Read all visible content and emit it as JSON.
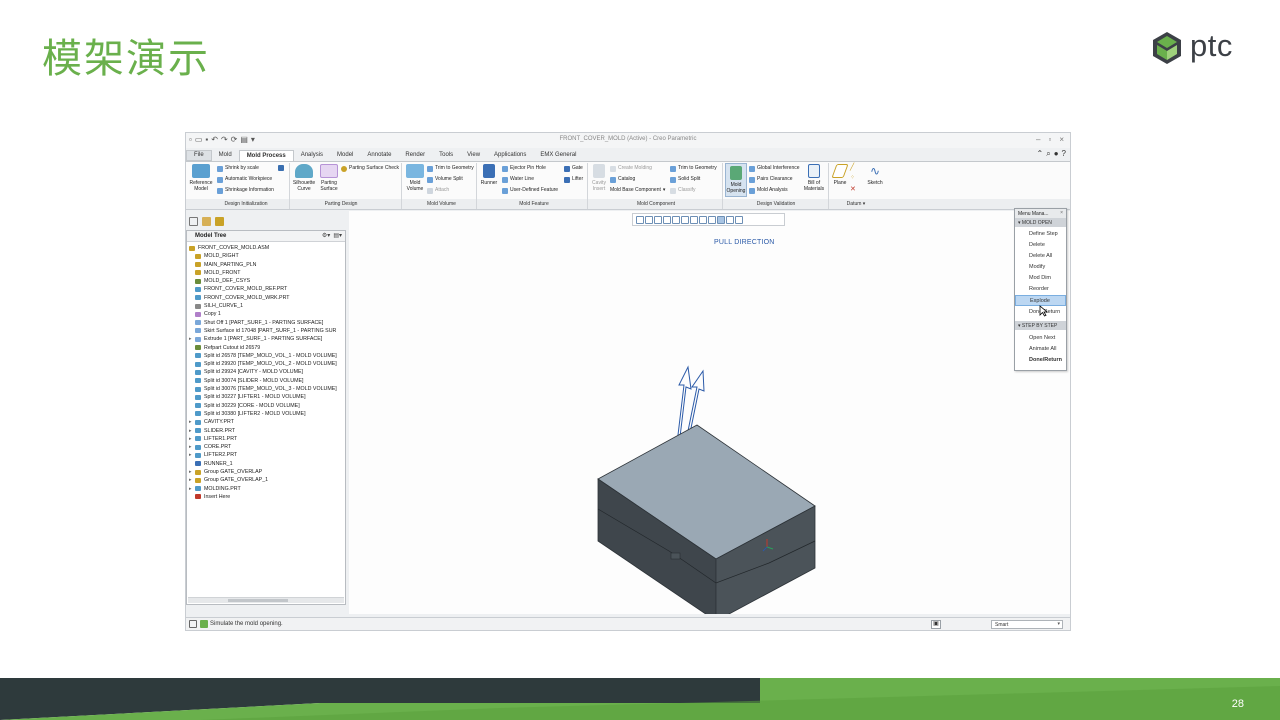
{
  "slide": {
    "title": "模架演示",
    "logo_text": "ptc",
    "page_number": "28",
    "colors": {
      "accent": "#6ab04c",
      "dark_bar": "#2e3a3c",
      "green_bar": "#6ab04c"
    }
  },
  "app": {
    "window_title": "FRONT_COVER_MOLD (Active) - Creo Parametric",
    "menus": [
      "File",
      "Mold",
      "Mold Process",
      "Analysis",
      "Model",
      "Annotate",
      "Render",
      "Tools",
      "View",
      "Applications",
      "EMX General"
    ],
    "active_menu": "Mold Process",
    "ribbon": {
      "reference_model": "Reference Model",
      "shrink_by_scale": "Shrink by scale",
      "automatic_workpiece": "Automatic Workpiece",
      "shrinkage_information": "Shrinkage Information",
      "silhouette_curve": "Silhouette Curve",
      "parting_surface": "Parting Surface",
      "parting_surface_check": "Parting Surface Check",
      "mold_volume": "Mold Volume",
      "trim_to_geometry": "Trim to Geometry",
      "volume_split": "Volume Split",
      "attach": "Attach",
      "runner": "Runner",
      "ejector_pin_hole": "Ejector Pin Hole",
      "water_line": "Water Line",
      "user_defined_feature": "User-Defined Feature",
      "gate": "Gate",
      "lifter": "Lifter",
      "cavity_insert": "Cavity Insert",
      "create_molding": "Create Molding",
      "catalog": "Catalog",
      "mold_base_component": "Mold Base Component",
      "trim_to_geometry_2": "Trim to Geometry",
      "solid_split": "Solid Split",
      "classify": "Classify",
      "mold_opening": "Mold Opening",
      "global_interference": "Global Interference",
      "pairs_clearance": "Pairs Clearance",
      "mold_analysis": "Mold Analysis",
      "bill_of_materials": "Bill of Materials",
      "plane": "Plane",
      "sketch": "Sketch"
    },
    "groups": [
      "Design Initialization",
      "Parting Design",
      "Mold Volume",
      "Mold Feature",
      "Mold Component",
      "Design Validation",
      "Datum"
    ],
    "model_tree": {
      "header": "Model Tree",
      "items": [
        {
          "label": "FRONT_COVER_MOLD.ASM",
          "level": 0,
          "expand": false,
          "icon": "#c9a227"
        },
        {
          "label": "MOLD_RIGHT",
          "level": 1,
          "expand": false,
          "icon": "#c9a227"
        },
        {
          "label": "MAIN_PARTING_PLN",
          "level": 1,
          "expand": false,
          "icon": "#c9a227"
        },
        {
          "label": "MOLD_FRONT",
          "level": 1,
          "expand": false,
          "icon": "#c9a227"
        },
        {
          "label": "MOLD_DEF_CSYS",
          "level": 1,
          "expand": false,
          "icon": "#6a8c3a"
        },
        {
          "label": "FRONT_COVER_MOLD_REF.PRT",
          "level": 1,
          "expand": false,
          "icon": "#4f9ac9"
        },
        {
          "label": "FRONT_COVER_MOLD_WRK.PRT",
          "level": 1,
          "expand": false,
          "icon": "#4f9ac9"
        },
        {
          "label": "SILH_CURVE_1",
          "level": 1,
          "expand": false,
          "icon": "#888888"
        },
        {
          "label": "Copy 1",
          "level": 1,
          "expand": false,
          "icon": "#b07fc9"
        },
        {
          "label": "Shut Off 1 [PART_SURF_1 - PARTING SURFACE]",
          "level": 1,
          "expand": false,
          "icon": "#7aa7d9"
        },
        {
          "label": "Skirt Surface id 17048 [PART_SURF_1 - PARTING SUR",
          "level": 1,
          "expand": false,
          "icon": "#7aa7d9"
        },
        {
          "label": "Extrude 1 [PART_SURF_1 - PARTING SURFACE]",
          "level": 1,
          "expand": true,
          "icon": "#7aa7d9"
        },
        {
          "label": "Refpart Cutout id 26579",
          "level": 1,
          "expand": false,
          "icon": "#6a8c3a"
        },
        {
          "label": "Split id 26578 [TEMP_MOLD_VOL_1 - MOLD VOLUME]",
          "level": 1,
          "expand": false,
          "icon": "#4f9ac9"
        },
        {
          "label": "Split id 29920 [TEMP_MOLD_VOL_2 - MOLD VOLUME]",
          "level": 1,
          "expand": false,
          "icon": "#4f9ac9"
        },
        {
          "label": "Split id 29924 [CAVITY - MOLD VOLUME]",
          "level": 1,
          "expand": false,
          "icon": "#4f9ac9"
        },
        {
          "label": "Split id 30074 [SLIDER - MOLD VOLUME]",
          "level": 1,
          "expand": false,
          "icon": "#4f9ac9"
        },
        {
          "label": "Split id 30076 [TEMP_MOLD_VOL_3 - MOLD VOLUME]",
          "level": 1,
          "expand": false,
          "icon": "#4f9ac9"
        },
        {
          "label": "Split id 30227 [LIFTER1 - MOLD VOLUME]",
          "level": 1,
          "expand": false,
          "icon": "#4f9ac9"
        },
        {
          "label": "Split id 30229 [CORE - MOLD VOLUME]",
          "level": 1,
          "expand": false,
          "icon": "#4f9ac9"
        },
        {
          "label": "Split id 30380 [LIFTER2 - MOLD VOLUME]",
          "level": 1,
          "expand": false,
          "icon": "#4f9ac9"
        },
        {
          "label": "CAVITY.PRT",
          "level": 1,
          "expand": true,
          "icon": "#4f9ac9"
        },
        {
          "label": "SLIDER.PRT",
          "level": 1,
          "expand": true,
          "icon": "#4f9ac9"
        },
        {
          "label": "LIFTER1.PRT",
          "level": 1,
          "expand": true,
          "icon": "#4f9ac9"
        },
        {
          "label": "CORE.PRT",
          "level": 1,
          "expand": true,
          "icon": "#4f9ac9"
        },
        {
          "label": "LIFTER2.PRT",
          "level": 1,
          "expand": true,
          "icon": "#4f9ac9"
        },
        {
          "label": "RUNNER_1",
          "level": 1,
          "expand": false,
          "icon": "#3b6fb5"
        },
        {
          "label": "Group GATE_OVERLAP",
          "level": 1,
          "expand": true,
          "icon": "#c9a227"
        },
        {
          "label": "Group GATE_OVERLAP_1",
          "level": 1,
          "expand": true,
          "icon": "#c9a227"
        },
        {
          "label": "MOLDING.PRT",
          "level": 1,
          "expand": true,
          "icon": "#4f9ac9"
        },
        {
          "label": "Insert Here",
          "level": 1,
          "expand": false,
          "icon": "#c0392b"
        }
      ]
    },
    "graphics": {
      "pull_direction_label": "PULL DIRECTION"
    },
    "menu_manager": {
      "title": "Menu Mana...",
      "section1": "MOLD OPEN",
      "items1": [
        "Define Step",
        "Delete",
        "Delete All",
        "Modify",
        "Mod Dim",
        "Reorder",
        "Explode",
        "Done/Return"
      ],
      "highlighted": "Explode",
      "section2": "STEP BY STEP",
      "items2": [
        "Open Next",
        "Animate All",
        "Done/Return"
      ]
    },
    "status": {
      "message": "Simulate the mold opening.",
      "filter": "Smart"
    }
  }
}
